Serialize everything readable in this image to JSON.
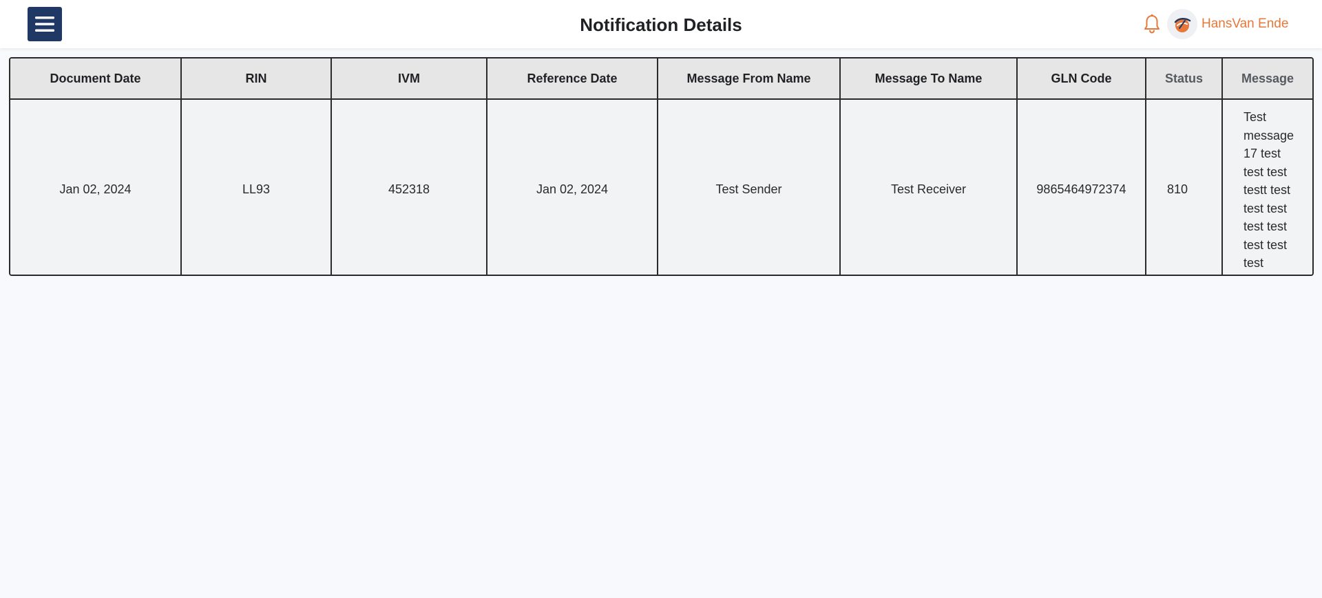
{
  "header": {
    "title": "Notification Details",
    "user_name": "HansVan Ende",
    "menu_icon": "hamburger-menu-icon",
    "bell_icon": "bell-icon",
    "accent_color": "#e8773a",
    "menu_bg_color": "#1f3864"
  },
  "table": {
    "columns": [
      "Document Date",
      "RIN",
      "IVM",
      "Reference Date",
      "Message From Name",
      "Message To Name",
      "GLN Code",
      "Status",
      "Message"
    ],
    "rows": [
      {
        "document_date": "Jan 02, 2024",
        "rin": "LL93",
        "ivm": "452318",
        "reference_date": "Jan 02, 2024",
        "from_name": "Test Sender",
        "to_name": "Test Receiver",
        "gln_code": "9865464972374",
        "status": "810",
        "message": "Test message 17 test test test testt test test test test test test test test"
      }
    ]
  }
}
